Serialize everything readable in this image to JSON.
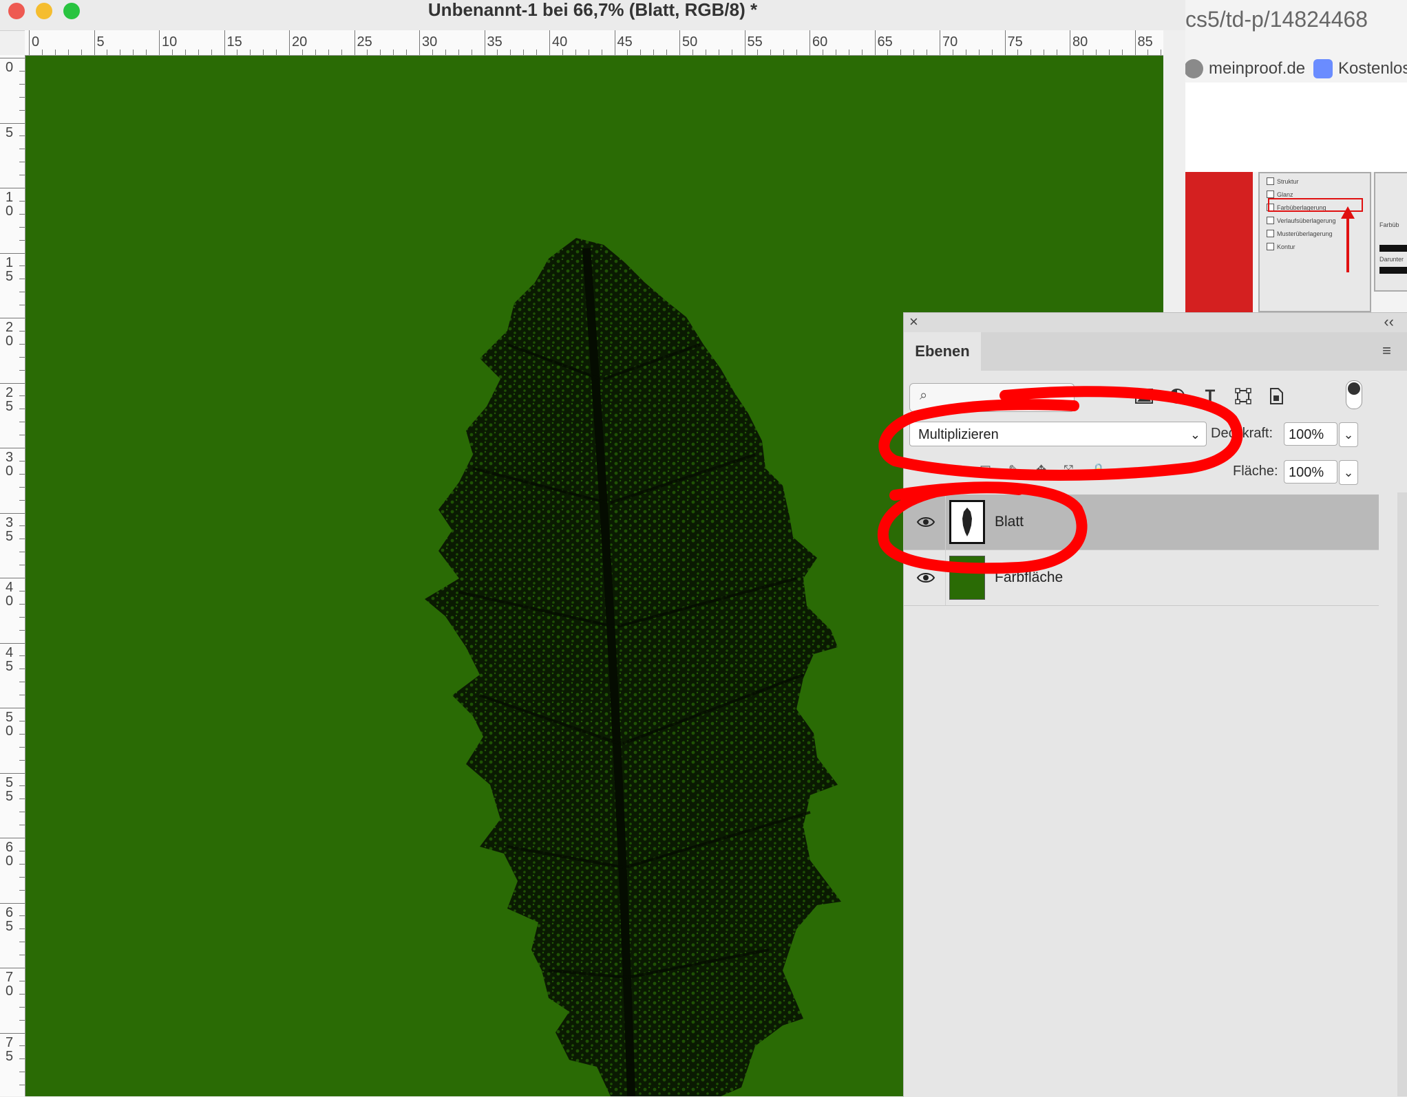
{
  "window": {
    "title": "Unbenannt-1 bei 66,7% (Blatt, RGB/8) *"
  },
  "ruler": {
    "h_labels": [
      "0",
      "5",
      "10",
      "15",
      "20",
      "25",
      "30",
      "35",
      "40",
      "45",
      "50",
      "55",
      "60",
      "65",
      "70",
      "75",
      "80",
      "85"
    ],
    "v_labels": [
      "0",
      "5",
      "10",
      "15",
      "20",
      "25",
      "30",
      "35",
      "40",
      "45",
      "50",
      "55",
      "60",
      "65",
      "70",
      "75"
    ]
  },
  "browser": {
    "url_fragment": "cs5/td-p/14824468",
    "bookmarks": [
      {
        "label": "meinproof.de",
        "icon": "meinproof-icon"
      },
      {
        "label": "Kostenlos",
        "icon": "form-icon"
      }
    ],
    "screenshot_items": [
      "Struktur",
      "Glanz",
      "Farbüberlagerung",
      "Verlaufsüberlagerung",
      "Musterüberlagerung",
      "Kontur"
    ],
    "screenshot_side": [
      "Farbüb",
      "Darunter"
    ]
  },
  "layers_panel": {
    "tab": "Ebenen",
    "blend_mode": "Multiplizieren",
    "opacity_label": "Deckkraft:",
    "opacity_value": "100%",
    "fill_label": "Fläche:",
    "fill_value": "100%",
    "layers": [
      {
        "name": "Blatt",
        "selected": true,
        "visible": true
      },
      {
        "name": "Farbfläche",
        "selected": false,
        "visible": true,
        "color": "#2a6b05"
      }
    ]
  },
  "colors": {
    "canvas_green": "#2a6b05",
    "annotation_red": "#ff0000",
    "close_red": "#ee5a52",
    "minimize_yellow": "#f5bd2f",
    "zoom_green": "#29c440"
  }
}
